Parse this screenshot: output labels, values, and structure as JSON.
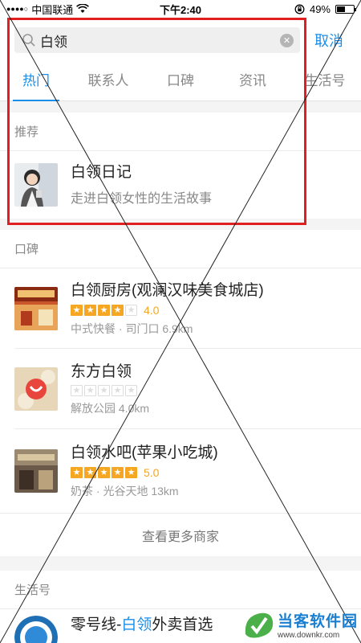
{
  "status_bar": {
    "carrier": "中国联通",
    "time": "下午2:40",
    "battery": "49%",
    "battery_level": 0.49
  },
  "search": {
    "value": "白领",
    "cancel_label": "取消"
  },
  "tabs": [
    {
      "label": "热门",
      "active": true
    },
    {
      "label": "联系人",
      "active": false
    },
    {
      "label": "口碑",
      "active": false
    },
    {
      "label": "资讯",
      "active": false
    },
    {
      "label": "生活号",
      "active": false
    }
  ],
  "recommend": {
    "header": "推荐",
    "item": {
      "title": "白领日记",
      "subtitle": "走进白领女性的生活故事"
    }
  },
  "koubei": {
    "header": "口碑",
    "items": [
      {
        "title": "白领厨房(观澜汉味美食城店)",
        "rating": 4,
        "rating_label": "4.0",
        "meta": "中式快餐 · 司门口 6.9km"
      },
      {
        "title": "东方白领",
        "rating": 0,
        "rating_label": "",
        "meta": "解放公园 4.0km"
      },
      {
        "title": "白领水吧(苹果小吃城)",
        "rating": 5,
        "rating_label": "5.0",
        "meta": "奶茶 · 光谷天地 13km"
      }
    ],
    "more_label": "查看更多商家"
  },
  "life": {
    "header": "生活号",
    "item": {
      "title_prefix": "零号线-",
      "title_keyword": "白领",
      "title_suffix": "外卖首选"
    }
  },
  "watermark": {
    "name": "当客软件园",
    "url": "www.downkr.com"
  },
  "colors": {
    "accent": "#1a8ee8",
    "star": "#f5a623",
    "highlight": "#e02020"
  }
}
